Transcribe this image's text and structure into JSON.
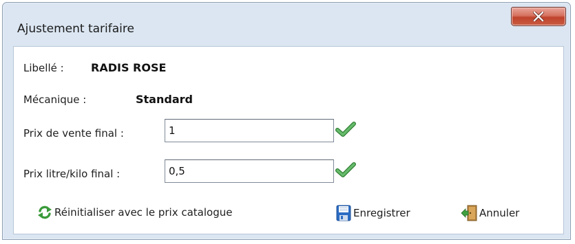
{
  "window": {
    "title": "Ajustement tarifaire",
    "close_icon": "close-icon"
  },
  "info": {
    "libelle_label": "Libellé :",
    "libelle_value": "RADIS ROSE",
    "mecanique_label": "Mécanique :",
    "mecanique_value": "Standard"
  },
  "fields": {
    "prix_vente": {
      "label": "Prix de vente final :",
      "value": "1",
      "status_icon": "check-icon"
    },
    "prix_litre": {
      "label": "Prix litre/kilo final :",
      "value": "0,5",
      "status_icon": "check-icon"
    }
  },
  "actions": {
    "reset": {
      "label": "Réinitialiser avec le prix catalogue",
      "icon": "refresh-icon"
    },
    "save": {
      "label": "Enregistrer",
      "icon": "floppy-disk-icon"
    },
    "cancel": {
      "label": "Annuler",
      "icon": "exit-door-icon"
    }
  },
  "colors": {
    "close_button": "#c7452e",
    "check": "#4caf50",
    "refresh": "#3a9a3a",
    "floppy": "#2b6cc4"
  }
}
